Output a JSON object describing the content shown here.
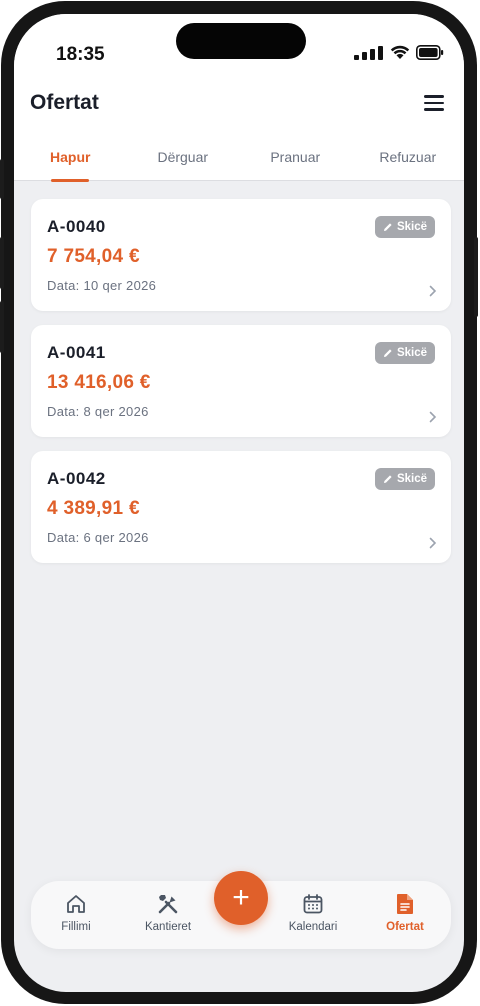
{
  "status": {
    "time": "18:35"
  },
  "header": {
    "title": "Ofertat"
  },
  "tabs": [
    {
      "label": "Hapur",
      "active": true
    },
    {
      "label": "Dërguar",
      "active": false
    },
    {
      "label": "Pranuar",
      "active": false
    },
    {
      "label": "Refuzuar",
      "active": false
    }
  ],
  "offers": [
    {
      "number": "A-0040",
      "amount": "7 754,04 €",
      "date": "Data: 10 qer 2026",
      "status": "Skicë"
    },
    {
      "number": "A-0041",
      "amount": "13 416,06 €",
      "date": "Data: 8 qer 2026",
      "status": "Skicë"
    },
    {
      "number": "A-0042",
      "amount": "4 389,91 €",
      "date": "Data: 6 qer 2026",
      "status": "Skicë"
    }
  ],
  "nav": {
    "items": [
      {
        "label": "Fillimi",
        "icon": "home-icon"
      },
      {
        "label": "Kantieret",
        "icon": "tools-icon"
      },
      {
        "label": "Kalendari",
        "icon": "calendar-icon"
      },
      {
        "label": "Ofertat",
        "icon": "document-icon",
        "active": true
      }
    ],
    "fab_symbol": "+"
  },
  "colors": {
    "accent": "#e0602a",
    "badge": "#a6a8ad",
    "background": "#eeeff2"
  }
}
